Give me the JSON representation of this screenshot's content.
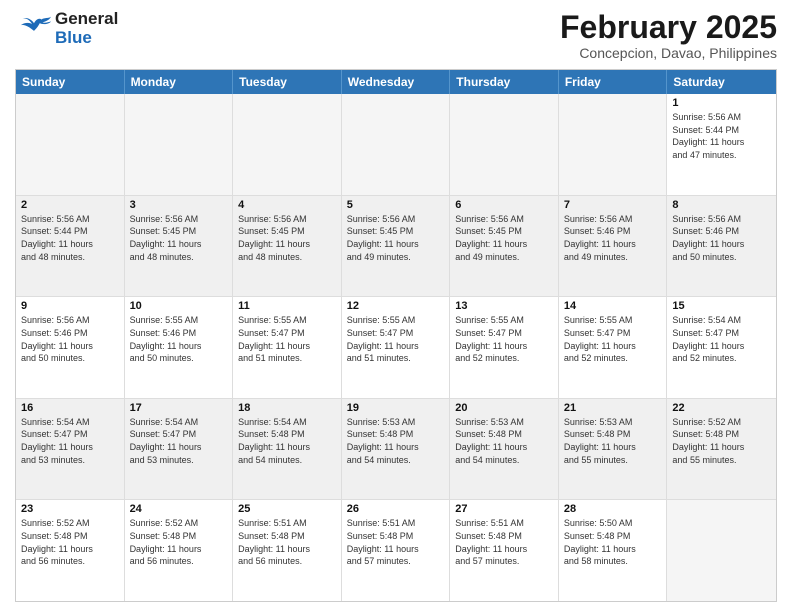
{
  "header": {
    "logo_general": "General",
    "logo_blue": "Blue",
    "month_title": "February 2025",
    "location": "Concepcion, Davao, Philippines"
  },
  "weekdays": [
    "Sunday",
    "Monday",
    "Tuesday",
    "Wednesday",
    "Thursday",
    "Friday",
    "Saturday"
  ],
  "weeks": [
    [
      {
        "day": "",
        "info": ""
      },
      {
        "day": "",
        "info": ""
      },
      {
        "day": "",
        "info": ""
      },
      {
        "day": "",
        "info": ""
      },
      {
        "day": "",
        "info": ""
      },
      {
        "day": "",
        "info": ""
      },
      {
        "day": "1",
        "info": "Sunrise: 5:56 AM\nSunset: 5:44 PM\nDaylight: 11 hours\nand 47 minutes."
      }
    ],
    [
      {
        "day": "2",
        "info": "Sunrise: 5:56 AM\nSunset: 5:44 PM\nDaylight: 11 hours\nand 48 minutes."
      },
      {
        "day": "3",
        "info": "Sunrise: 5:56 AM\nSunset: 5:45 PM\nDaylight: 11 hours\nand 48 minutes."
      },
      {
        "day": "4",
        "info": "Sunrise: 5:56 AM\nSunset: 5:45 PM\nDaylight: 11 hours\nand 48 minutes."
      },
      {
        "day": "5",
        "info": "Sunrise: 5:56 AM\nSunset: 5:45 PM\nDaylight: 11 hours\nand 49 minutes."
      },
      {
        "day": "6",
        "info": "Sunrise: 5:56 AM\nSunset: 5:45 PM\nDaylight: 11 hours\nand 49 minutes."
      },
      {
        "day": "7",
        "info": "Sunrise: 5:56 AM\nSunset: 5:46 PM\nDaylight: 11 hours\nand 49 minutes."
      },
      {
        "day": "8",
        "info": "Sunrise: 5:56 AM\nSunset: 5:46 PM\nDaylight: 11 hours\nand 50 minutes."
      }
    ],
    [
      {
        "day": "9",
        "info": "Sunrise: 5:56 AM\nSunset: 5:46 PM\nDaylight: 11 hours\nand 50 minutes."
      },
      {
        "day": "10",
        "info": "Sunrise: 5:55 AM\nSunset: 5:46 PM\nDaylight: 11 hours\nand 50 minutes."
      },
      {
        "day": "11",
        "info": "Sunrise: 5:55 AM\nSunset: 5:47 PM\nDaylight: 11 hours\nand 51 minutes."
      },
      {
        "day": "12",
        "info": "Sunrise: 5:55 AM\nSunset: 5:47 PM\nDaylight: 11 hours\nand 51 minutes."
      },
      {
        "day": "13",
        "info": "Sunrise: 5:55 AM\nSunset: 5:47 PM\nDaylight: 11 hours\nand 52 minutes."
      },
      {
        "day": "14",
        "info": "Sunrise: 5:55 AM\nSunset: 5:47 PM\nDaylight: 11 hours\nand 52 minutes."
      },
      {
        "day": "15",
        "info": "Sunrise: 5:54 AM\nSunset: 5:47 PM\nDaylight: 11 hours\nand 52 minutes."
      }
    ],
    [
      {
        "day": "16",
        "info": "Sunrise: 5:54 AM\nSunset: 5:47 PM\nDaylight: 11 hours\nand 53 minutes."
      },
      {
        "day": "17",
        "info": "Sunrise: 5:54 AM\nSunset: 5:47 PM\nDaylight: 11 hours\nand 53 minutes."
      },
      {
        "day": "18",
        "info": "Sunrise: 5:54 AM\nSunset: 5:48 PM\nDaylight: 11 hours\nand 54 minutes."
      },
      {
        "day": "19",
        "info": "Sunrise: 5:53 AM\nSunset: 5:48 PM\nDaylight: 11 hours\nand 54 minutes."
      },
      {
        "day": "20",
        "info": "Sunrise: 5:53 AM\nSunset: 5:48 PM\nDaylight: 11 hours\nand 54 minutes."
      },
      {
        "day": "21",
        "info": "Sunrise: 5:53 AM\nSunset: 5:48 PM\nDaylight: 11 hours\nand 55 minutes."
      },
      {
        "day": "22",
        "info": "Sunrise: 5:52 AM\nSunset: 5:48 PM\nDaylight: 11 hours\nand 55 minutes."
      }
    ],
    [
      {
        "day": "23",
        "info": "Sunrise: 5:52 AM\nSunset: 5:48 PM\nDaylight: 11 hours\nand 56 minutes."
      },
      {
        "day": "24",
        "info": "Sunrise: 5:52 AM\nSunset: 5:48 PM\nDaylight: 11 hours\nand 56 minutes."
      },
      {
        "day": "25",
        "info": "Sunrise: 5:51 AM\nSunset: 5:48 PM\nDaylight: 11 hours\nand 56 minutes."
      },
      {
        "day": "26",
        "info": "Sunrise: 5:51 AM\nSunset: 5:48 PM\nDaylight: 11 hours\nand 57 minutes."
      },
      {
        "day": "27",
        "info": "Sunrise: 5:51 AM\nSunset: 5:48 PM\nDaylight: 11 hours\nand 57 minutes."
      },
      {
        "day": "28",
        "info": "Sunrise: 5:50 AM\nSunset: 5:48 PM\nDaylight: 11 hours\nand 58 minutes."
      },
      {
        "day": "",
        "info": ""
      }
    ]
  ]
}
